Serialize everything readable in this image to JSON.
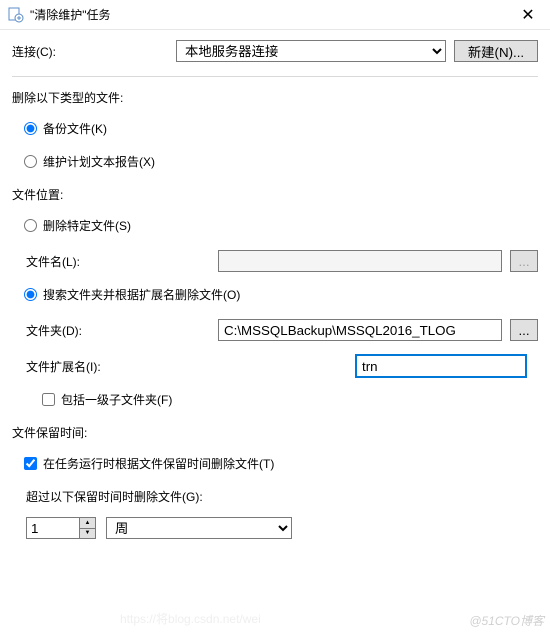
{
  "titlebar": {
    "title": "\"清除维护\"任务"
  },
  "connection": {
    "label": "连接(C):",
    "value": "本地服务器连接",
    "new_button": "新建(N)..."
  },
  "delete_types": {
    "heading": "删除以下类型的文件:",
    "backup_files": "备份文件(K)",
    "maint_reports": "维护计划文本报告(X)"
  },
  "file_location": {
    "heading": "文件位置:",
    "specific_file": "删除特定文件(S)",
    "file_name_label": "文件名(L):",
    "search_folder": "搜索文件夹并根据扩展名删除文件(O)",
    "folder_label": "文件夹(D):",
    "folder_value": "C:\\MSSQLBackup\\MSSQL2016_TLOG",
    "ext_label": "文件扩展名(I):",
    "ext_value": "trn",
    "include_sub": "包括一级子文件夹(F)",
    "browse": "..."
  },
  "retention": {
    "heading": "文件保留时间:",
    "check_label": "在任务运行时根据文件保留时间删除文件(T)",
    "threshold_label": "超过以下保留时间时删除文件(G):",
    "number": "1",
    "unit": "周"
  },
  "watermarks": {
    "main": "@51CTO博客",
    "sub": "https://将blog.csdn.net/wei"
  }
}
